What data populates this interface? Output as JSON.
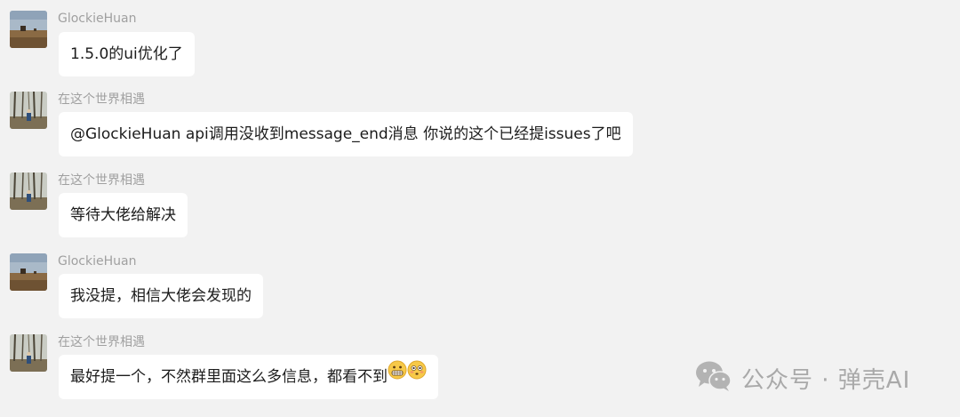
{
  "messages": [
    {
      "sender": "GlockieHuan",
      "avatar": "landscape-avatar",
      "text": "1.5.0的ui优化了"
    },
    {
      "sender": "在这个世界相遇",
      "avatar": "forest-avatar",
      "text": "@GlockieHuan api调用没收到message_end消息  你说的这个已经提issues了吧"
    },
    {
      "sender": "在这个世界相遇",
      "avatar": "forest-avatar",
      "text": "等待大佬给解决"
    },
    {
      "sender": "GlockieHuan",
      "avatar": "landscape-avatar",
      "text": "我没提，相信大佬会发现的"
    },
    {
      "sender": "在这个世界相遇",
      "avatar": "forest-avatar",
      "text": "最好提一个，不然群里面这么多信息，都看不到",
      "emojis": [
        "grimacing-emoji",
        "flushed-emoji"
      ]
    }
  ],
  "watermark": {
    "text": "公众号 · 弹壳AI",
    "icon": "wechat-icon"
  },
  "colors": {
    "background": "#f2f2f2",
    "bubble": "#ffffff",
    "sender_text": "#a0a0a0",
    "message_text": "#1c1c1c",
    "watermark": "#a9a9a9"
  }
}
